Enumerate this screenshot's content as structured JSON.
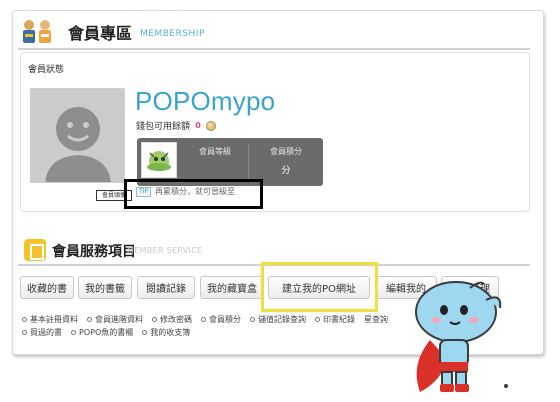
{
  "header": {
    "title": "會員專區",
    "subtitle": "MEMBERSHIP"
  },
  "status": {
    "label": "會員狀態",
    "username": "POPOmypo",
    "wallet_label": "錢包可用餘額",
    "wallet_count": "0",
    "avatar_caption": "會員頭像",
    "level": {
      "label": "會員等級",
      "points_label": "會員積分",
      "points_value": "分"
    },
    "tip_badge": "TIP",
    "tip_text": "再累積分，就可晉級至"
  },
  "services": {
    "title": "會員服務項目",
    "subtitle": "MEMBER SERVICE",
    "buttons": [
      {
        "label": "收藏的書"
      },
      {
        "label": "我的書籤"
      },
      {
        "label": "閱讀記錄"
      },
      {
        "label": "我的藏寶盒"
      },
      {
        "label": "建立我的PO網址"
      },
      {
        "label": "編輯我的"
      },
      {
        "label": "留言管理"
      }
    ],
    "links_row1": [
      "基本註冊資料",
      "會員進階資料",
      "修改密碼",
      "會員積分",
      "儲值記錄查詢",
      "印書紀錄",
      "星查詢"
    ],
    "links_row2": [
      "買過的書",
      "POPO魚的書櫃",
      "我的收支簿"
    ]
  },
  "colors": {
    "accent": "#3aa3cf",
    "highlight_yellow": "#f4de3a",
    "panel_gray": "#6b6b6b"
  },
  "icons": [
    "membership-people-icon",
    "service-book-icon",
    "coin-icon",
    "mascot-character"
  ]
}
